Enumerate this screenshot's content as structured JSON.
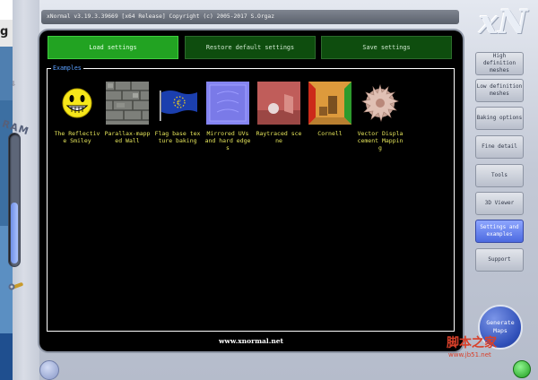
{
  "window": {
    "title": "xNormal v3.19.3.39669 [x64 Release] Copyright (c) 2005-2017 S.Orgaz",
    "logo": "xN"
  },
  "left_rail": {
    "ram_label": "RAM",
    "ram_level_percent": 48,
    "desktop_letter": "g"
  },
  "toolbar": {
    "load": "Load settings",
    "restore": "Restore default settings",
    "save": "Save settings"
  },
  "examples": {
    "label": "Examples",
    "items": [
      {
        "label": "The Reflective Smiley"
      },
      {
        "label": "Parallax-mapped Wall"
      },
      {
        "label": "Flag base texture baking"
      },
      {
        "label": "Mirrored UVs and hard edges"
      },
      {
        "label": "Raytraced scene"
      },
      {
        "label": "Cornell"
      },
      {
        "label": "Vector Displacement Mapping"
      }
    ]
  },
  "website": "www.xnormal.net",
  "sidebar": {
    "items": [
      {
        "label": "High definition meshes"
      },
      {
        "label": "Low definition meshes"
      },
      {
        "label": "Baking options"
      },
      {
        "label": "Fine detail"
      },
      {
        "label": "Tools"
      },
      {
        "label": "3D Viewer"
      },
      {
        "label": "Settings and examples"
      },
      {
        "label": "Support"
      }
    ],
    "generate": "Generate Maps"
  },
  "watermark": {
    "line1": "脚本之家",
    "line2": "www.jb51.net"
  },
  "colors": {
    "accent_green": "#22a322",
    "example_text": "#e4e45a",
    "group_label": "#5aa0ff",
    "active_sidebar": "#5b78f0"
  }
}
